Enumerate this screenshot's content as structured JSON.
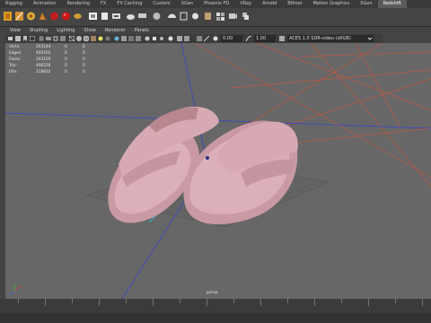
{
  "shelf": {
    "tabs": [
      "Rigging",
      "Animation",
      "Rendering",
      "FX",
      "FX Caching",
      "Custom",
      "XGen",
      "Phoenix FD",
      "VRay",
      "Arnold",
      "Bifrost",
      "Motion Graphics",
      "XGen",
      "Redshift"
    ],
    "active_tab": 13
  },
  "panel_menu": [
    "View",
    "Shading",
    "Lighting",
    "Show",
    "Renderer",
    "Panels"
  ],
  "toolbar": {
    "exposure": "0.00",
    "gamma": "1.00",
    "color_space": "ACES 1.0 SDR-video (sRGB)"
  },
  "hud": {
    "rows": [
      {
        "label": "Verts:",
        "v1": "203144",
        "v2": "0",
        "v3": "0"
      },
      {
        "label": "Edges:",
        "v1": "406102",
        "v2": "0",
        "v3": "0"
      },
      {
        "label": "Faces:",
        "v1": "203159",
        "v2": "0",
        "v3": "0"
      },
      {
        "label": "Tris:",
        "v1": "406228",
        "v2": "0",
        "v3": "0"
      },
      {
        "label": "UVs:",
        "v1": "218832",
        "v2": "0",
        "v3": "0"
      }
    ]
  },
  "camera_label": "persp",
  "colors": {
    "viewport_bg": "#676767",
    "model": "#d9aab4",
    "grid": "#5b5b5b",
    "camera_lines": "#c0583f",
    "axis_blue": "#3a46c8",
    "axis_cyan": "#3cb8d8"
  },
  "icons": [
    "joint-icon",
    "ik-handle-icon",
    "bind-skin-icon",
    "paint-weights-icon",
    "mirror-icon",
    "redshift-render-icon",
    "redshift-ipr-icon",
    "redshift-light-icon",
    "material-icon",
    "redshift-settings-icon",
    "proxy-icon",
    "cube-icon",
    "sphere-icon",
    "dome-light-icon",
    "area-light-icon",
    "volume-icon",
    "texture-icon",
    "aov-icon",
    "camera-icon",
    "instance-icon"
  ]
}
